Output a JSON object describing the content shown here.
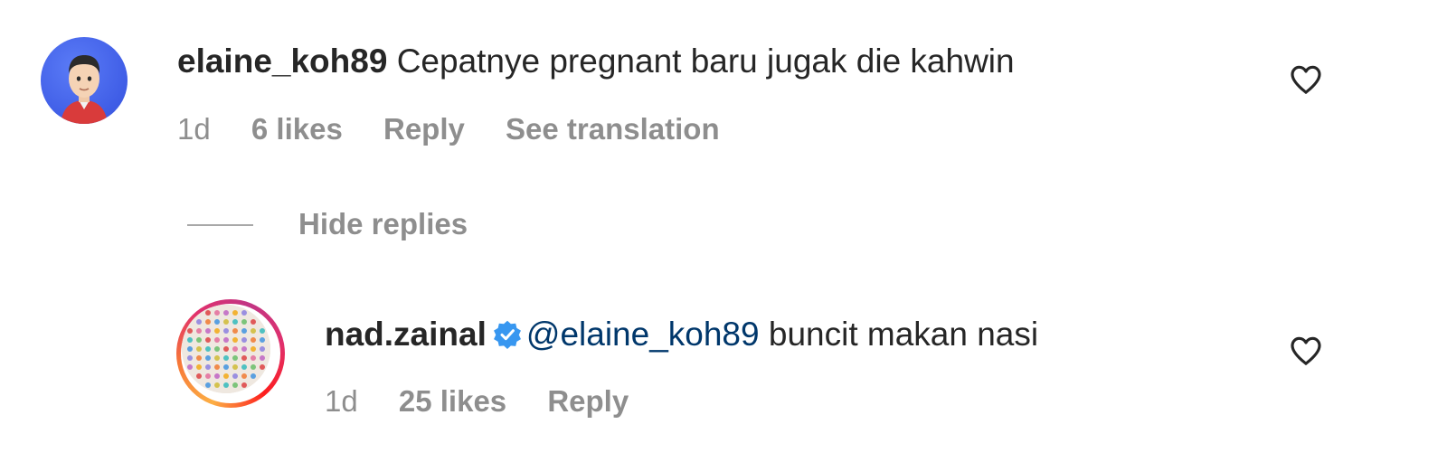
{
  "comments": [
    {
      "username": "elaine_koh89",
      "text": "Cepatnye pregnant baru jugak die kahwin",
      "time": "1d",
      "likes": "6 likes",
      "reply_label": "Reply",
      "translate_label": "See translation",
      "avatar_icon": "memoji-avatar-icon",
      "like_icon": "heart-outline-icon"
    }
  ],
  "thread": {
    "hide_replies_label": "Hide replies"
  },
  "replies": [
    {
      "username": "nad.zainal",
      "verified": true,
      "mention": "@elaine_koh89",
      "text": "buncit makan nasi",
      "time": "1d",
      "likes": "25 likes",
      "reply_label": "Reply",
      "avatar_icon": "dot-pattern-avatar-icon",
      "like_icon": "heart-outline-icon"
    }
  ],
  "colors": {
    "text": "#262626",
    "muted": "#8e8e8e",
    "mention": "#00376b",
    "verified": "#0095f6",
    "avatar_bg": "#3f5de6"
  }
}
